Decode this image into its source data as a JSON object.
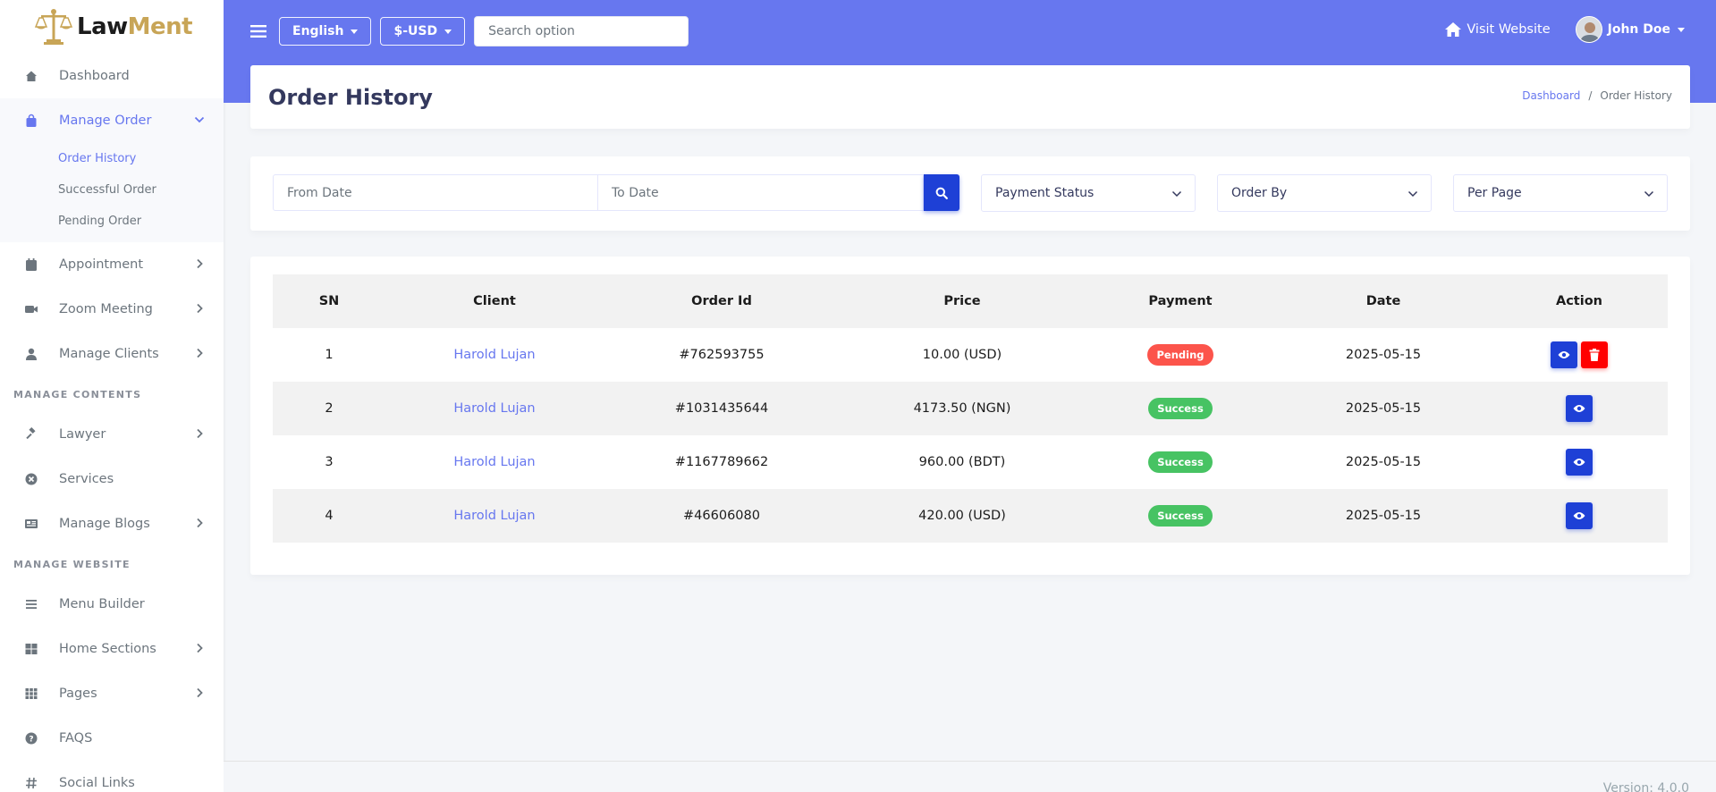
{
  "brand": {
    "part1": "Law",
    "part2": "Ment"
  },
  "sidebar": {
    "items": [
      {
        "label": "Dashboard"
      },
      {
        "label": "Manage Order",
        "sub": [
          "Order History",
          "Successful Order",
          "Pending Order"
        ]
      },
      {
        "label": "Appointment"
      },
      {
        "label": "Zoom Meeting"
      },
      {
        "label": "Manage Clients"
      },
      {
        "label": "Lawyer"
      },
      {
        "label": "Services"
      },
      {
        "label": "Manage Blogs"
      },
      {
        "label": "Menu Builder"
      },
      {
        "label": "Home Sections"
      },
      {
        "label": "Pages"
      },
      {
        "label": "FAQS"
      },
      {
        "label": "Social Links"
      }
    ],
    "headers": [
      "MANAGE CONTENTS",
      "MANAGE WEBSITE"
    ]
  },
  "topbar": {
    "language": "English",
    "currency": "$-USD",
    "search_placeholder": "Search option",
    "visit_website": "Visit Website",
    "user_name": "John Doe"
  },
  "page": {
    "title": "Order History",
    "breadcrumb": [
      "Dashboard",
      "/",
      "Order History"
    ]
  },
  "filters": {
    "from_date": "From Date",
    "to_date": "To Date",
    "payment_status": "Payment Status",
    "order_by": "Order By",
    "per_page": "Per Page"
  },
  "table": {
    "headers": [
      "SN",
      "Client",
      "Order Id",
      "Price",
      "Payment",
      "Date",
      "Action"
    ],
    "rows": [
      {
        "sn": "1",
        "client": "Harold Lujan",
        "order_id": "#762593755",
        "price": "10.00 (USD)",
        "payment": "Pending",
        "date": "2025-05-15"
      },
      {
        "sn": "2",
        "client": "Harold Lujan",
        "order_id": "#1031435644",
        "price": "4173.50 (NGN)",
        "payment": "Success",
        "date": "2025-05-15"
      },
      {
        "sn": "3",
        "client": "Harold Lujan",
        "order_id": "#1167789662",
        "price": "960.00 (BDT)",
        "payment": "Success",
        "date": "2025-05-15"
      },
      {
        "sn": "4",
        "client": "Harold Lujan",
        "order_id": "#46606080",
        "price": "420.00 (USD)",
        "payment": "Success",
        "date": "2025-05-15"
      }
    ]
  },
  "footer": {
    "version": "Version: 4.0.0"
  },
  "colors": {
    "primary": "#6777ef",
    "action_blue": "#1e40d6",
    "danger": "#fc544b",
    "success": "#47c363",
    "gold": "#c8a557"
  }
}
